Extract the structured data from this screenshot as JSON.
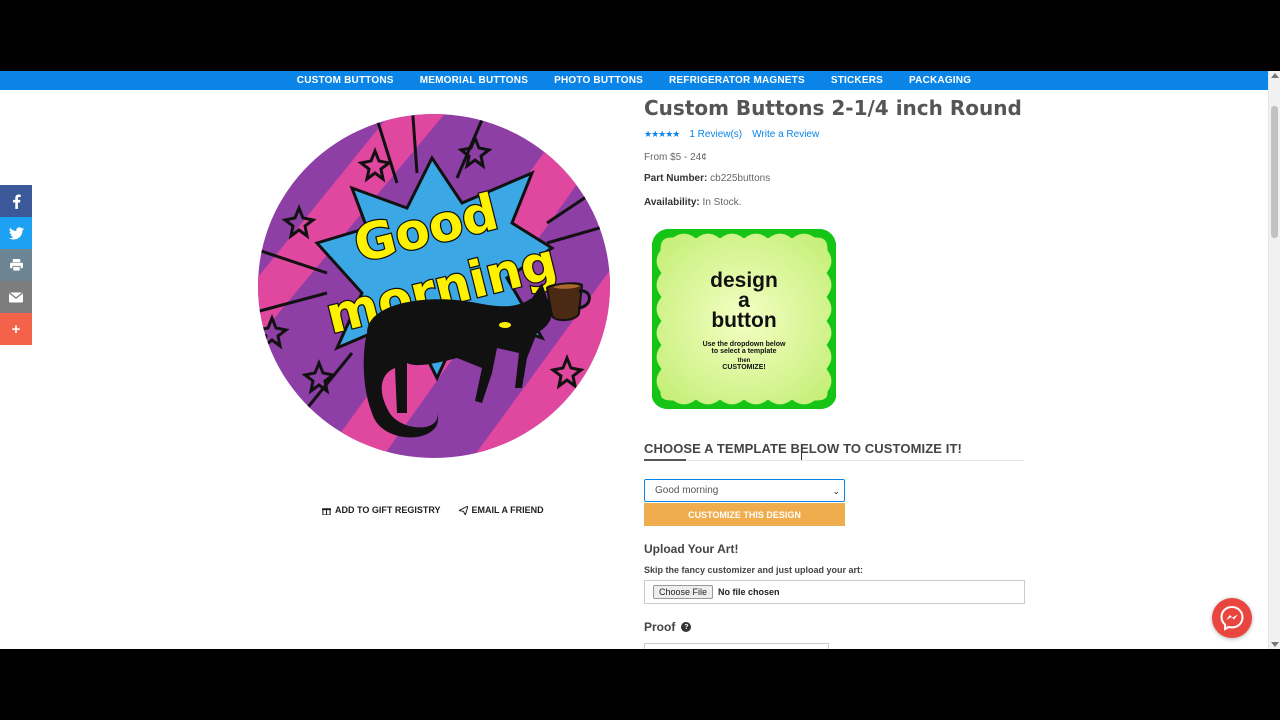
{
  "nav": {
    "items": [
      "CUSTOM BUTTONS",
      "MEMORIAL BUTTONS",
      "PHOTO BUTTONS",
      "REFRIGERATOR MAGNETS",
      "STICKERS",
      "PACKAGING"
    ]
  },
  "share": {
    "icons": [
      "facebook-icon",
      "twitter-icon",
      "print-icon",
      "email-icon",
      "plus-icon"
    ],
    "plus_label": "+"
  },
  "product_image": {
    "text_line1": "Good",
    "text_line2": "morning"
  },
  "gift": {
    "registry_label": "ADD TO GIFT REGISTRY",
    "email_label": "EMAIL A FRIEND"
  },
  "product": {
    "title": "Custom Buttons 2-1/4 inch Round",
    "rating_stars": 5,
    "reviews_label": "1 Review(s)",
    "write_review_label": "Write a Review",
    "price": "From $5 - 24¢",
    "part_number_label": "Part Number:",
    "part_number": "cb225buttons",
    "availability_label": "Availability:",
    "availability": "In Stock."
  },
  "design_image": {
    "line1": "design",
    "line2": "a",
    "line3": "button",
    "line4": "Use the dropdown below",
    "line5": "to select a template",
    "line6": "then",
    "line7": "CUSTOMIZE!"
  },
  "template": {
    "heading": "CHOOSE A TEMPLATE BELOW TO CUSTOMIZE IT!",
    "selected": "Good morning",
    "customize_label": "CUSTOMIZE THIS DESIGN"
  },
  "upload": {
    "heading": "Upload Your Art!",
    "subtext": "Skip the fancy customizer and just upload your art:",
    "choose_file_label": "Choose File",
    "status": "No file chosen"
  },
  "proof": {
    "heading": "Proof"
  },
  "colors": {
    "nav_blue": "#0a84e6",
    "customize_orange": "#f0ad4e",
    "messenger_red": "#e8463f"
  }
}
